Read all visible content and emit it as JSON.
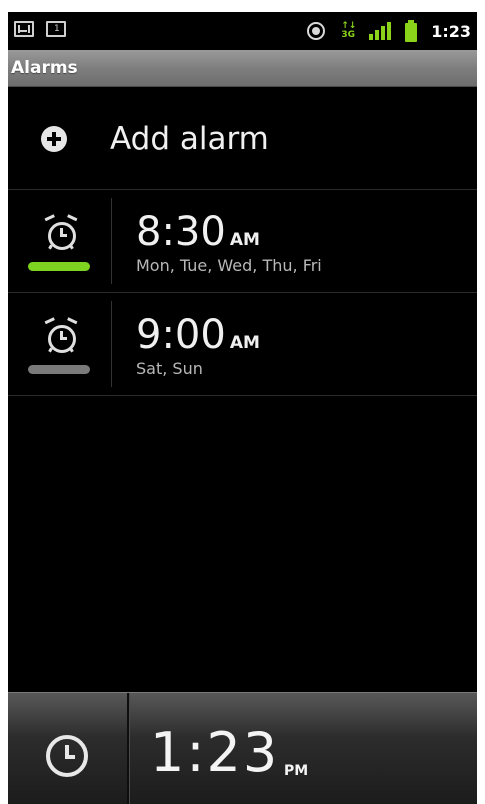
{
  "status_bar": {
    "icons_left": [
      "gmail-icon",
      "calendar-icon"
    ],
    "calendar_day": "1",
    "icons_right": [
      "gps-icon",
      "data-3g-icon",
      "signal-icon",
      "battery-icon"
    ],
    "network_top": "↑↓",
    "network_bottom": "3G",
    "time": "1:23",
    "accent_color": "#8bd21a"
  },
  "title_bar": {
    "title": "Alarms"
  },
  "add_alarm": {
    "icon": "plus-circle-icon",
    "label": "Add alarm"
  },
  "alarms": [
    {
      "time": "8:30",
      "ampm": "AM",
      "days": "Mon, Tue, Wed, Thu, Fri",
      "enabled": true,
      "indicator_color": "#7ed321"
    },
    {
      "time": "9:00",
      "ampm": "AM",
      "days": "Sat, Sun",
      "enabled": false,
      "indicator_color": "#7a7a7a"
    }
  ],
  "bottom_clock": {
    "icon": "clock-icon",
    "time": "1:23",
    "ampm": "PM"
  }
}
